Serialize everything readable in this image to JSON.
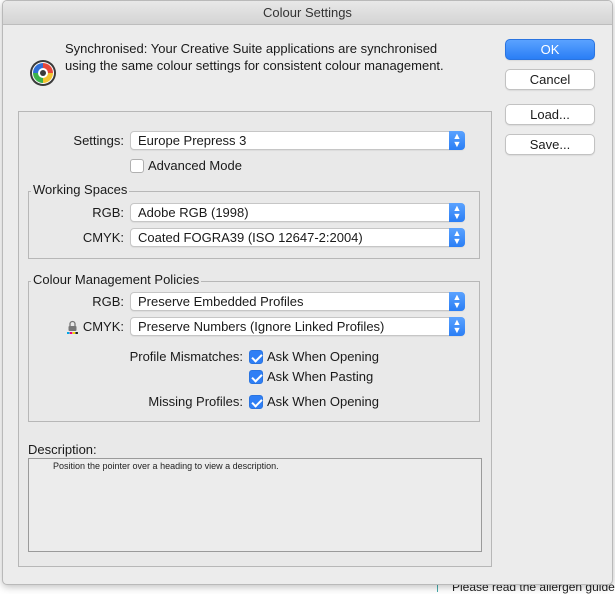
{
  "window": {
    "title": "Colour Settings"
  },
  "header": {
    "sync_line1": "Synchronised: Your Creative Suite applications are synchronised",
    "sync_line2": "using the same colour settings for consistent colour management."
  },
  "buttons": {
    "ok": "OK",
    "cancel": "Cancel",
    "load": "Load...",
    "save": "Save..."
  },
  "settings": {
    "label": "Settings:",
    "value": "Europe Prepress 3",
    "advanced_mode": {
      "label": "Advanced Mode",
      "checked": false
    }
  },
  "working_spaces": {
    "title": "Working Spaces",
    "rgb": {
      "label": "RGB:",
      "value": "Adobe RGB (1998)"
    },
    "cmyk": {
      "label": "CMYK:",
      "value": "Coated FOGRA39 (ISO 12647-2:2004)"
    }
  },
  "policies": {
    "title": "Colour Management Policies",
    "rgb": {
      "label": "RGB:",
      "value": "Preserve Embedded Profiles"
    },
    "cmyk": {
      "label": "CMYK:",
      "value": "Preserve Numbers (Ignore Linked Profiles)"
    },
    "profile_mismatches": {
      "label": "Profile Mismatches:",
      "ask_opening": {
        "label": "Ask When Opening",
        "checked": true
      },
      "ask_pasting": {
        "label": "Ask When Pasting",
        "checked": true
      }
    },
    "missing_profiles": {
      "label": "Missing Profiles:",
      "ask_opening": {
        "label": "Ask When Opening",
        "checked": true
      }
    }
  },
  "description": {
    "title": "Description:",
    "text": "Position the pointer over a heading to view a description."
  },
  "background": {
    "text": "Please read the allergen guide"
  },
  "colors": {
    "accent": "#2f7ff5",
    "window_bg": "#ececec"
  }
}
